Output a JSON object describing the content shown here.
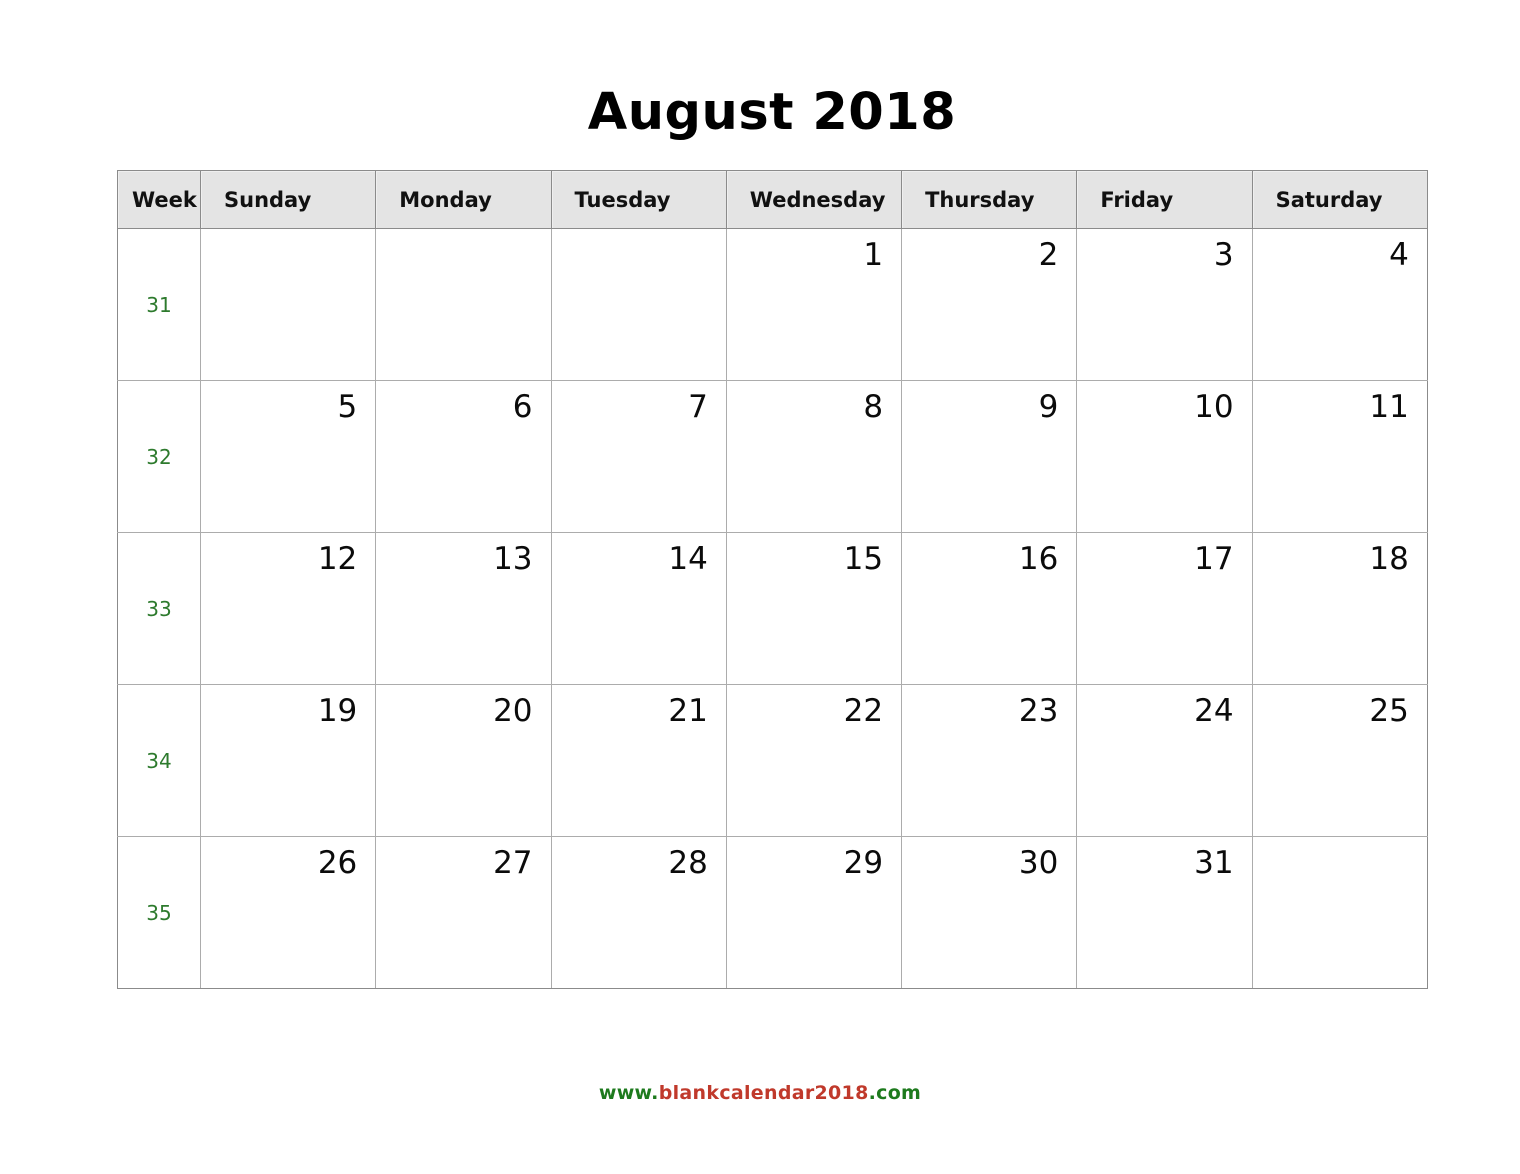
{
  "document": {
    "title": "August 2018"
  },
  "calendar": {
    "month_label": "August 2018",
    "week_column_header": "Week",
    "day_headers": [
      "Sunday",
      "Monday",
      "Tuesday",
      "Wednesday",
      "Thursday",
      "Friday",
      "Saturday"
    ],
    "week_numbers": [
      "31",
      "32",
      "33",
      "34",
      "35"
    ],
    "rows": [
      {
        "week": "31",
        "days": [
          "",
          "",
          "",
          "1",
          "2",
          "3",
          "4"
        ]
      },
      {
        "week": "32",
        "days": [
          "5",
          "6",
          "7",
          "8",
          "9",
          "10",
          "11"
        ]
      },
      {
        "week": "33",
        "days": [
          "12",
          "13",
          "14",
          "15",
          "16",
          "17",
          "18"
        ]
      },
      {
        "week": "34",
        "days": [
          "19",
          "20",
          "21",
          "22",
          "23",
          "24",
          "25"
        ]
      },
      {
        "week": "35",
        "days": [
          "26",
          "27",
          "28",
          "29",
          "30",
          "31",
          ""
        ]
      }
    ]
  },
  "footer": {
    "prefix": "www.",
    "domain": "blankcalendar2018",
    "suffix": ".com",
    "full_text": "www.blankcalendar2018.com"
  },
  "colors": {
    "week_number": "#2d7a2d",
    "header_background": "#e4e4e4",
    "header_border": "#8b8b8b",
    "cell_border": "#acacac",
    "day_number": "#0b0b0b",
    "footer_green": "#1d7a1d",
    "footer_red": "#c0392b"
  }
}
